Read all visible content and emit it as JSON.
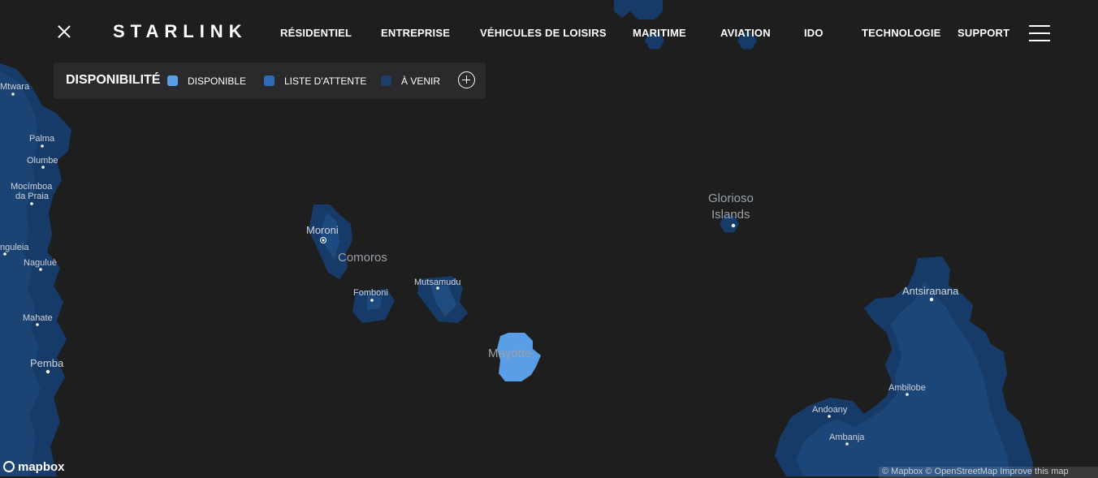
{
  "header": {
    "logo": "STARLINK",
    "nav": [
      {
        "label": "RÉSIDENTIEL"
      },
      {
        "label": "ENTREPRISE"
      },
      {
        "label": "VÉHICULES DE LOISIRS"
      },
      {
        "label": "MARITIME"
      },
      {
        "label": "AVIATION"
      },
      {
        "label": "IDO"
      },
      {
        "label": "TECHNOLOGIE"
      },
      {
        "label": "SUPPORT"
      }
    ]
  },
  "legend": {
    "title": "DISPONIBILITÉ",
    "items": [
      {
        "label": "DISPONIBLE",
        "color": "#5a9fe6"
      },
      {
        "label": "LISTE D'ATTENTE",
        "color": "#2e6cb8"
      },
      {
        "label": "À VENIR",
        "color": "#1c3f6a"
      }
    ]
  },
  "map": {
    "water_color": "#1e1e1f",
    "coverage_color": "#173b68",
    "available_color": "#5a9fe6",
    "labels": {
      "mtwara": "Mtwara",
      "palma": "Palma",
      "olumbe": "Olumbe",
      "mocimboa_1": "Mocímboa",
      "mocimboa_2": "da Praia",
      "ingoleia": "ngulеia",
      "nagulue": "Naguluè",
      "mahate": "Mahate",
      "pemba": "Pemba",
      "moroni": "Moroni",
      "comoros": "Comoros",
      "fomboni": "Fomboni",
      "mutsamudu": "Mutsamudu",
      "mayotte": "Mayotte",
      "glorioso_1": "Glorioso",
      "glorioso_2": "Islands",
      "antsiranana": "Antsiranana",
      "ambilobe": "Ambilobe",
      "andoany": "Andoany",
      "ambanja": "Ambanja"
    }
  },
  "footer": {
    "mapbox": "mapbox",
    "attribution": "© Mapbox © OpenStreetMap  Improve this map"
  }
}
